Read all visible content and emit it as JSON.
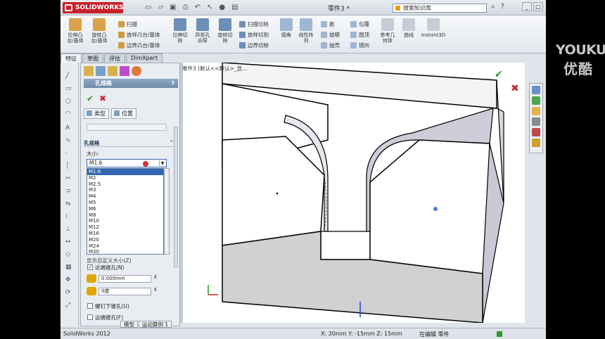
{
  "watermark": {
    "line1": "YOUKU",
    "line2": "优酷"
  },
  "titlebar": {
    "logo": "SOLIDWORKS",
    "doc_title": "零件3 *",
    "search_placeholder": "搜索知识库"
  },
  "ribbon": {
    "extrude": "拉伸凸\n台/基体",
    "revolve": "旋转凸\n台/基体",
    "sweep": "扫描",
    "loft": "放样凸台/基体",
    "boundary": "边界凸台/基体",
    "ext_cut": "拉伸切\n除",
    "hole_wizard": "异型孔\n向导",
    "rev_cut": "旋转切\n除",
    "sweep_cut": "扫描切除",
    "loft_cut": "放样切割",
    "boundary_cut": "边界切除",
    "fillet": "圆角",
    "linear_pattern": "线性阵\n列",
    "rib": "筋",
    "draft": "拔模",
    "shell": "抽壳",
    "wrap": "包覆",
    "intersect": "圆顶",
    "mirror": "镜向",
    "ref_geom": "参考几\n何体",
    "curves": "曲线",
    "instant3d": "Instant3D"
  },
  "feature_tabs": [
    "特征",
    "草图",
    "评估",
    "DimXpert"
  ],
  "property_manager": {
    "title": "孔规格",
    "help": "?",
    "tabs": [
      "类型",
      "位置"
    ],
    "section_hole_spec": "孔规格",
    "size_label": "大小:",
    "size_value": "M1.6",
    "sizes": [
      "M1.6",
      "M2",
      "M2.5",
      "M3",
      "M4",
      "M5",
      "M6",
      "M8",
      "M10",
      "M12",
      "M16",
      "M20",
      "M24",
      "M30"
    ],
    "custom_size": "显示自定义大小(Z)",
    "near_side": "近端锥孔(N)",
    "near_dia": "0.000mm",
    "near_angle": "0度",
    "under_head": "螺钉下锥孔(U)",
    "far_side": "远端锥孔(F)"
  },
  "viewport": {
    "breadcrumb": "零件3 (默认<<默认>_显..."
  },
  "bottom_tabs": [
    "模型",
    "运动算例 1"
  ],
  "status": {
    "app": "SolidWorks 2012",
    "coords": "X: 20mm Y: -15mm Z: 15mm",
    "mode": "在编辑 零件"
  }
}
